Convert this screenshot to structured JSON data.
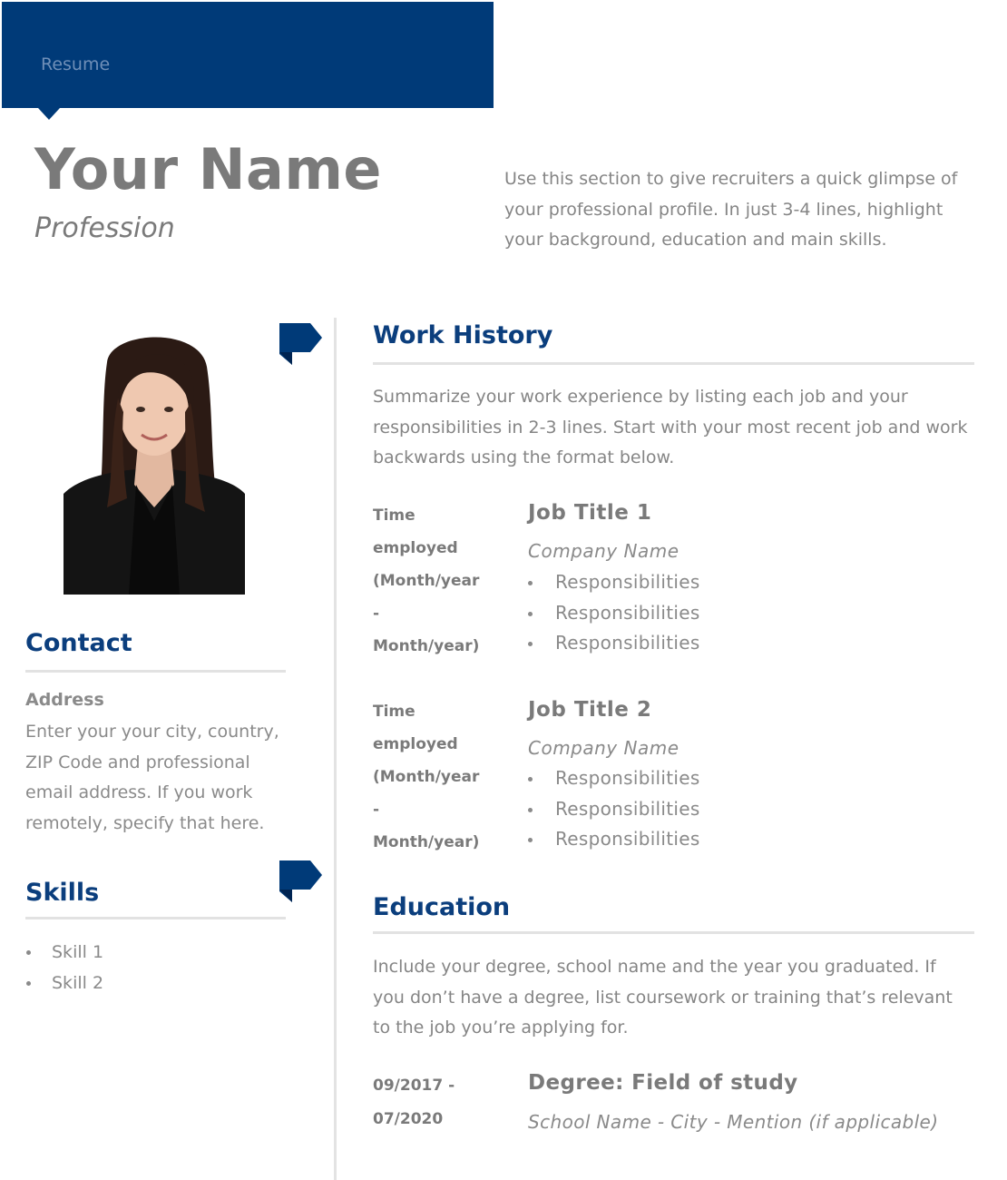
{
  "header": {
    "tab_label": "Resume",
    "name": "Your Name",
    "profession": "Profession",
    "summary": "Use this section to give recruiters a quick glimpse of your professional profile. In just 3-4 lines, highlight your background, education and main skills."
  },
  "colors": {
    "brand_blue": "#003a78",
    "heading_blue": "#0b3e7d",
    "body_gray": "#858585",
    "rule_gray": "#e2e2e2"
  },
  "contact": {
    "title": "Contact",
    "address_label": "Address",
    "address_text": "Enter your your city, country, ZIP Code and professional email address. If you work remotely, specify that here."
  },
  "skills": {
    "title": "Skills",
    "items": [
      "Skill 1",
      "Skill 2"
    ]
  },
  "work_history": {
    "title": "Work History",
    "intro": "Summarize your work experience by listing each job and your responsibilities in 2-3 lines. Start with your most recent job and work backwards using the format below.",
    "jobs": [
      {
        "time_lines": [
          "Time",
          "employed",
          "(Month/year",
          "-",
          "Month/year)"
        ],
        "title": "Job Title 1",
        "company": "Company Name",
        "responsibilities": [
          "Responsibilities",
          "Responsibilities",
          "Responsibilities"
        ]
      },
      {
        "time_lines": [
          "Time",
          "employed",
          "(Month/year",
          "-",
          "Month/year)"
        ],
        "title": "Job Title 2",
        "company": "Company Name",
        "responsibilities": [
          "Responsibilities",
          "Responsibilities",
          "Responsibilities"
        ]
      }
    ]
  },
  "education": {
    "title": "Education",
    "intro": "Include your degree, school name and the year you graduated. If you don’t have a degree, list coursework or training that’s relevant to the job you’re applying for.",
    "dates": [
      "09/2017 -",
      "07/2020"
    ],
    "degree": "Degree: Field of study",
    "school": "School Name - City - Mention (if applicable)"
  },
  "icons": {
    "flag": "flag-icon"
  }
}
